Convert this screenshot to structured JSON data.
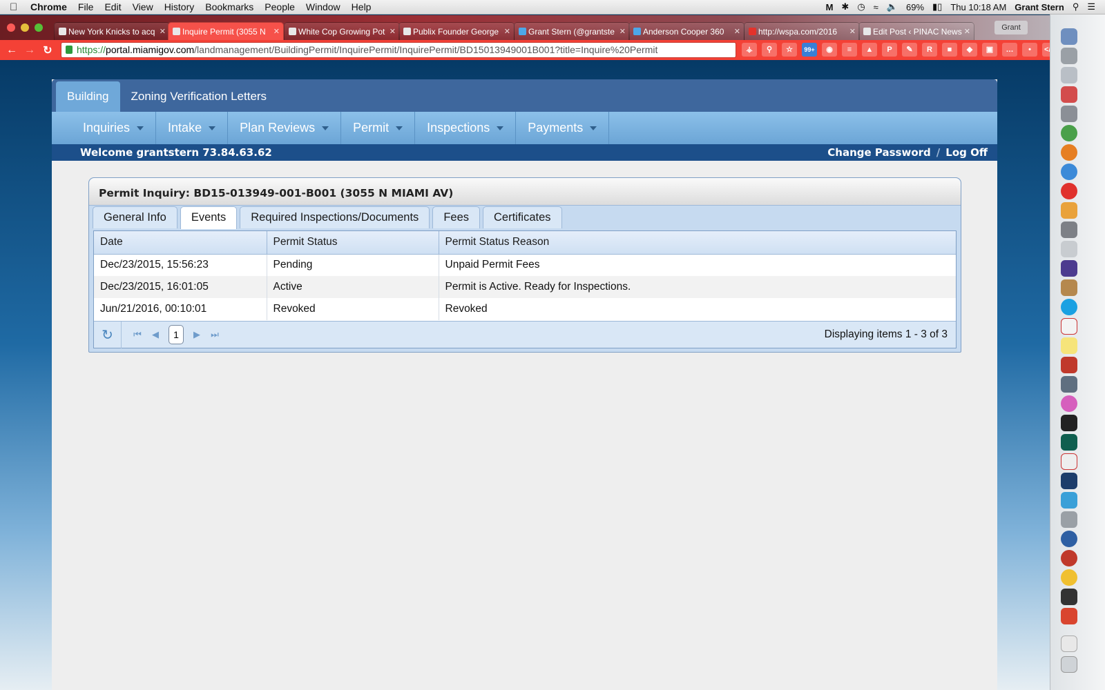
{
  "menubar": {
    "app": "Chrome",
    "items": [
      "File",
      "Edit",
      "View",
      "History",
      "Bookmarks",
      "People",
      "Window",
      "Help"
    ],
    "battery": "69%",
    "clock": "Thu 10:18 AM",
    "user": "Grant Stern"
  },
  "browser": {
    "tabs": [
      {
        "title": "New York Knicks to acq"
      },
      {
        "title": "Inquire Permit (3055 N"
      },
      {
        "title": "White Cop Growing Pot"
      },
      {
        "title": "Publix Founder George"
      },
      {
        "title": "Grant Stern (@grantste"
      },
      {
        "title": "Anderson Cooper 360"
      },
      {
        "title": "http://wspa.com/2016"
      },
      {
        "title": "Edit Post ‹ PINAC News"
      }
    ],
    "profile": "Grant",
    "url_scheme": "https://",
    "url_host": "portal.miamigov.com",
    "url_path": "/landmanagement/BuildingPermit/InquirePermit/InquirePermit/BD15013949001B001?title=Inquire%20Permit",
    "ext_badge": "99+"
  },
  "app": {
    "top_tabs": [
      "Building",
      "Zoning Verification Letters"
    ],
    "menu": [
      "Inquiries",
      "Intake",
      "Plan Reviews",
      "Permit",
      "Inspections",
      "Payments"
    ],
    "welcome": "Welcome grantstern 73.84.63.62",
    "change_password": "Change Password",
    "log_off": "Log Off"
  },
  "inquiry": {
    "title": "Permit Inquiry: BD15-013949-001-B001 (3055 N MIAMI AV)",
    "tabs": [
      "General Info",
      "Events",
      "Required Inspections/Documents",
      "Fees",
      "Certificates"
    ],
    "columns": [
      "Date",
      "Permit Status",
      "Permit Status Reason"
    ],
    "rows": [
      [
        "Dec/23/2015, 15:56:23",
        "Pending",
        "Unpaid Permit Fees"
      ],
      [
        "Dec/23/2015, 16:01:05",
        "Active",
        "Permit is Active. Ready for Inspections."
      ],
      [
        "Jun/21/2016, 00:10:01",
        "Revoked",
        "Revoked"
      ]
    ],
    "page": "1",
    "pager_info": "Displaying items 1 - 3 of 3"
  }
}
